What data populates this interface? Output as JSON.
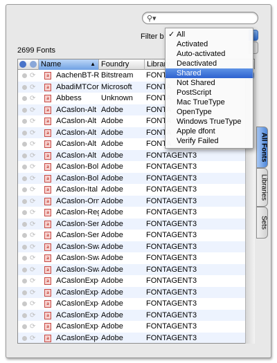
{
  "search": {
    "placeholder": "",
    "icon": "magnifier-icon"
  },
  "filter": {
    "label": "Filter b"
  },
  "font_count": "2699 Fonts",
  "table": {
    "columns": [
      "Name",
      "Foundry",
      "Library"
    ],
    "sort_indicator": "▲",
    "rows": [
      {
        "name": "AachenBT-R",
        "foundry": "Bitstream",
        "library": "FONTA"
      },
      {
        "name": "AbadiMTCor",
        "foundry": "Microsoft",
        "library": "FONTA"
      },
      {
        "name": "Abbess",
        "foundry": "Unknown",
        "library": "FONTA"
      },
      {
        "name": "ACaslon-Alt",
        "foundry": "Adobe",
        "library": "FONTA"
      },
      {
        "name": "ACaslon-Alt",
        "foundry": "Adobe",
        "library": "FONTA"
      },
      {
        "name": "ACaslon-Alt",
        "foundry": "Adobe",
        "library": "FONTA"
      },
      {
        "name": "ACaslon-Alt",
        "foundry": "Adobe",
        "library": "FONTA"
      },
      {
        "name": "ACaslon-Alt",
        "foundry": "Adobe",
        "library": "FONTAGENT3"
      },
      {
        "name": "ACaslon-Bol",
        "foundry": "Adobe",
        "library": "FONTAGENT3"
      },
      {
        "name": "ACaslon-Bol",
        "foundry": "Adobe",
        "library": "FONTAGENT3"
      },
      {
        "name": "ACaslon-Ital",
        "foundry": "Adobe",
        "library": "FONTAGENT3"
      },
      {
        "name": "ACaslon-Orn",
        "foundry": "Adobe",
        "library": "FONTAGENT3"
      },
      {
        "name": "ACaslon-Reg",
        "foundry": "Adobe",
        "library": "FONTAGENT3"
      },
      {
        "name": "ACaslon-Sen",
        "foundry": "Adobe",
        "library": "FONTAGENT3"
      },
      {
        "name": "ACaslon-Sen",
        "foundry": "Adobe",
        "library": "FONTAGENT3"
      },
      {
        "name": "ACaslon-Swa",
        "foundry": "Adobe",
        "library": "FONTAGENT3"
      },
      {
        "name": "ACaslon-Swa",
        "foundry": "Adobe",
        "library": "FONTAGENT3"
      },
      {
        "name": "ACaslon-Swa",
        "foundry": "Adobe",
        "library": "FONTAGENT3"
      },
      {
        "name": "ACaslonExp-",
        "foundry": "Adobe",
        "library": "FONTAGENT3"
      },
      {
        "name": "ACaslonExp-",
        "foundry": "Adobe",
        "library": "FONTAGENT3"
      },
      {
        "name": "ACaslonExp-",
        "foundry": "Adobe",
        "library": "FONTAGENT3"
      },
      {
        "name": "ACaslonExp-",
        "foundry": "Adobe",
        "library": "FONTAGENT3"
      },
      {
        "name": "ACaslonExp-",
        "foundry": "Adobe",
        "library": "FONTAGENT3"
      },
      {
        "name": "ACaslonExp-",
        "foundry": "Adobe",
        "library": "FONTAGENT3"
      }
    ]
  },
  "filter_menu": {
    "checked": "All",
    "selected": "Shared",
    "items": [
      "All",
      "Activated",
      "Auto-activated",
      "Deactivated",
      "Shared",
      "Not Shared",
      "PostScript",
      "Mac TrueType",
      "OpenType",
      "Windows TrueType",
      "Apple dfont",
      "Verify Failed"
    ]
  },
  "side_tabs": {
    "all_fonts": "All Fonts",
    "libraries": "Libraries",
    "sets": "Sets"
  },
  "colors": {
    "selection": "#2e62cf",
    "row_alt": "#edf3fe",
    "font_icon": "#c84a44"
  }
}
